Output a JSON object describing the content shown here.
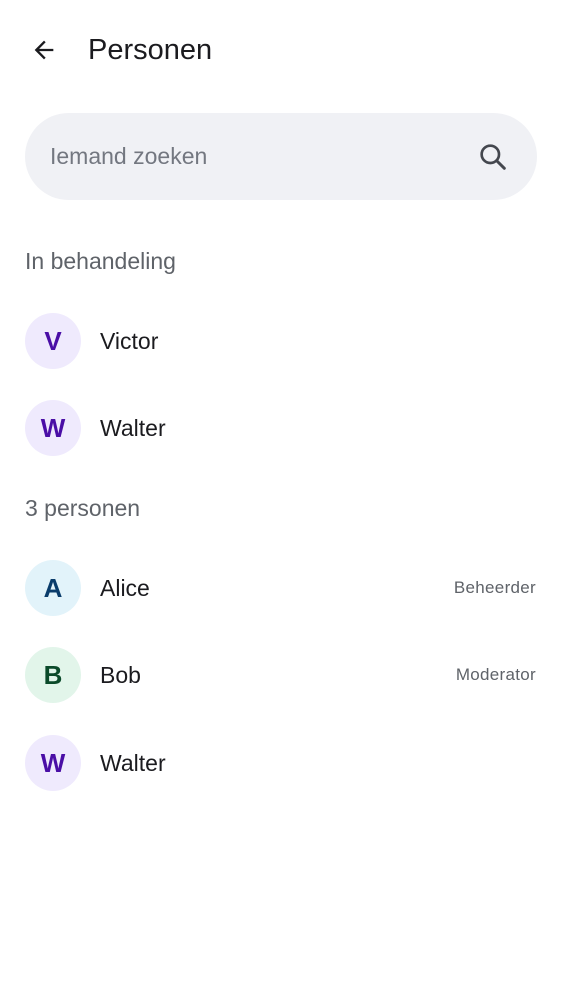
{
  "header": {
    "title": "Personen",
    "back_icon": "arrow-left-icon"
  },
  "search": {
    "placeholder": "Iemand zoeken",
    "value": "",
    "icon": "search-icon"
  },
  "pending": {
    "label": "In behandeling",
    "members": [
      {
        "initial": "V",
        "name": "Victor",
        "avatar_bg": "#efeafd",
        "avatar_fg": "#4a0ea6"
      },
      {
        "initial": "W",
        "name": "Walter",
        "avatar_bg": "#efeafd",
        "avatar_fg": "#4a0ea6"
      }
    ]
  },
  "members": {
    "label": "3 personen",
    "list": [
      {
        "initial": "A",
        "name": "Alice",
        "role": "Beheerder",
        "avatar_bg": "#e2f3fa",
        "avatar_fg": "#0a3c6b"
      },
      {
        "initial": "B",
        "name": "Bob",
        "role": "Moderator",
        "avatar_bg": "#e2f5ea",
        "avatar_fg": "#0b4a2a"
      },
      {
        "initial": "W",
        "name": "Walter",
        "role": "",
        "avatar_bg": "#efeafd",
        "avatar_fg": "#4a0ea6"
      }
    ]
  }
}
